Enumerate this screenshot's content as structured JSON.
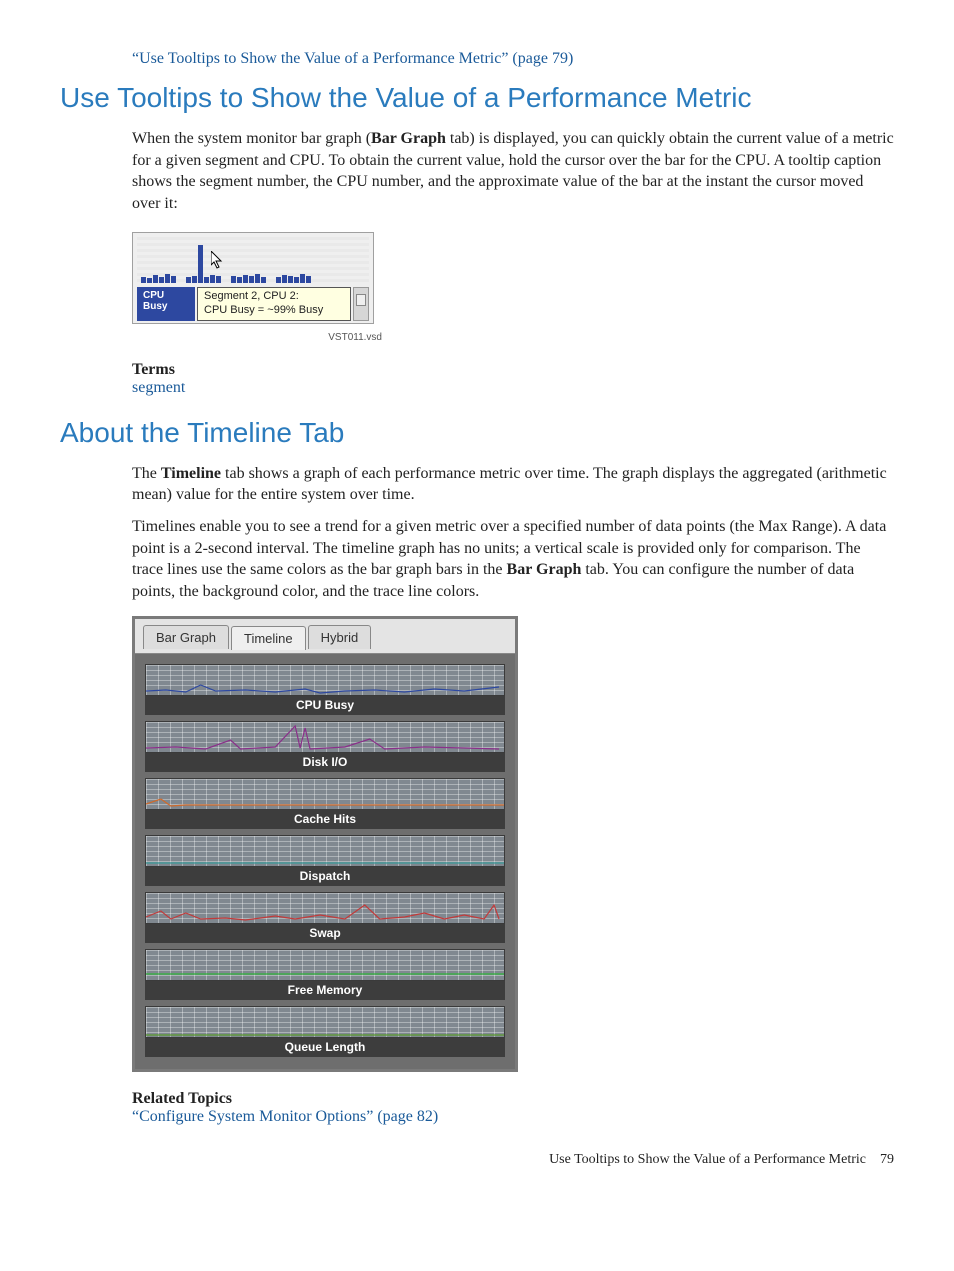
{
  "top_link": "“Use Tooltips to Show the Value of a Performance Metric” (page 79)",
  "section1": {
    "heading": "Use Tooltips to Show the Value of a Performance Metric",
    "para_pre": "When the system monitor bar graph (",
    "para_bold1": "Bar Graph",
    "para_post": " tab) is displayed, you can quickly obtain the current value of a metric for a given segment and CPU. To obtain the current value, hold the cursor over the bar for the CPU. A tooltip caption shows the segment number, the CPU number, and the approximate value of the bar at the instant the cursor moved over it:",
    "fig": {
      "cpu_busy_label": "CPU Busy",
      "tooltip_line1": "Segment 2, CPU 2:",
      "tooltip_line2": "CPU Busy = ~99% Busy",
      "caption": "VST011.vsd"
    },
    "terms_heading": "Terms",
    "terms_link": "segment"
  },
  "section2": {
    "heading": "About the Timeline Tab",
    "para1_pre": "The ",
    "para1_bold": "Timeline",
    "para1_post": " tab shows a graph of each performance metric over time. The graph displays the aggregated (arithmetic mean) value for the entire system over time.",
    "para2_pre": "Timelines enable you to see a trend for a given metric over a specified number of data points (the Max Range). A data point is a 2-second interval. The timeline graph has no units; a vertical scale is provided only for comparison. The trace lines use the same colors as the bar graph bars in the ",
    "para2_bold": "Bar Graph",
    "para2_post": " tab. You can configure the number of data points, the background color, and the trace line colors.",
    "tabs": {
      "bar": "Bar Graph",
      "timeline": "Timeline",
      "hybrid": "Hybrid"
    },
    "metrics": {
      "cpu_busy": "CPU Busy",
      "disk_io": "Disk I/O",
      "cache_hits": "Cache Hits",
      "dispatch": "Dispatch",
      "swap": "Swap",
      "free_memory": "Free Memory",
      "queue_length": "Queue Length"
    }
  },
  "related": {
    "heading": "Related Topics",
    "link": "“Configure System Monitor Options” (page 82)"
  },
  "footer": {
    "title": "Use Tooltips to Show the Value of a Performance Metric",
    "page": "79"
  }
}
